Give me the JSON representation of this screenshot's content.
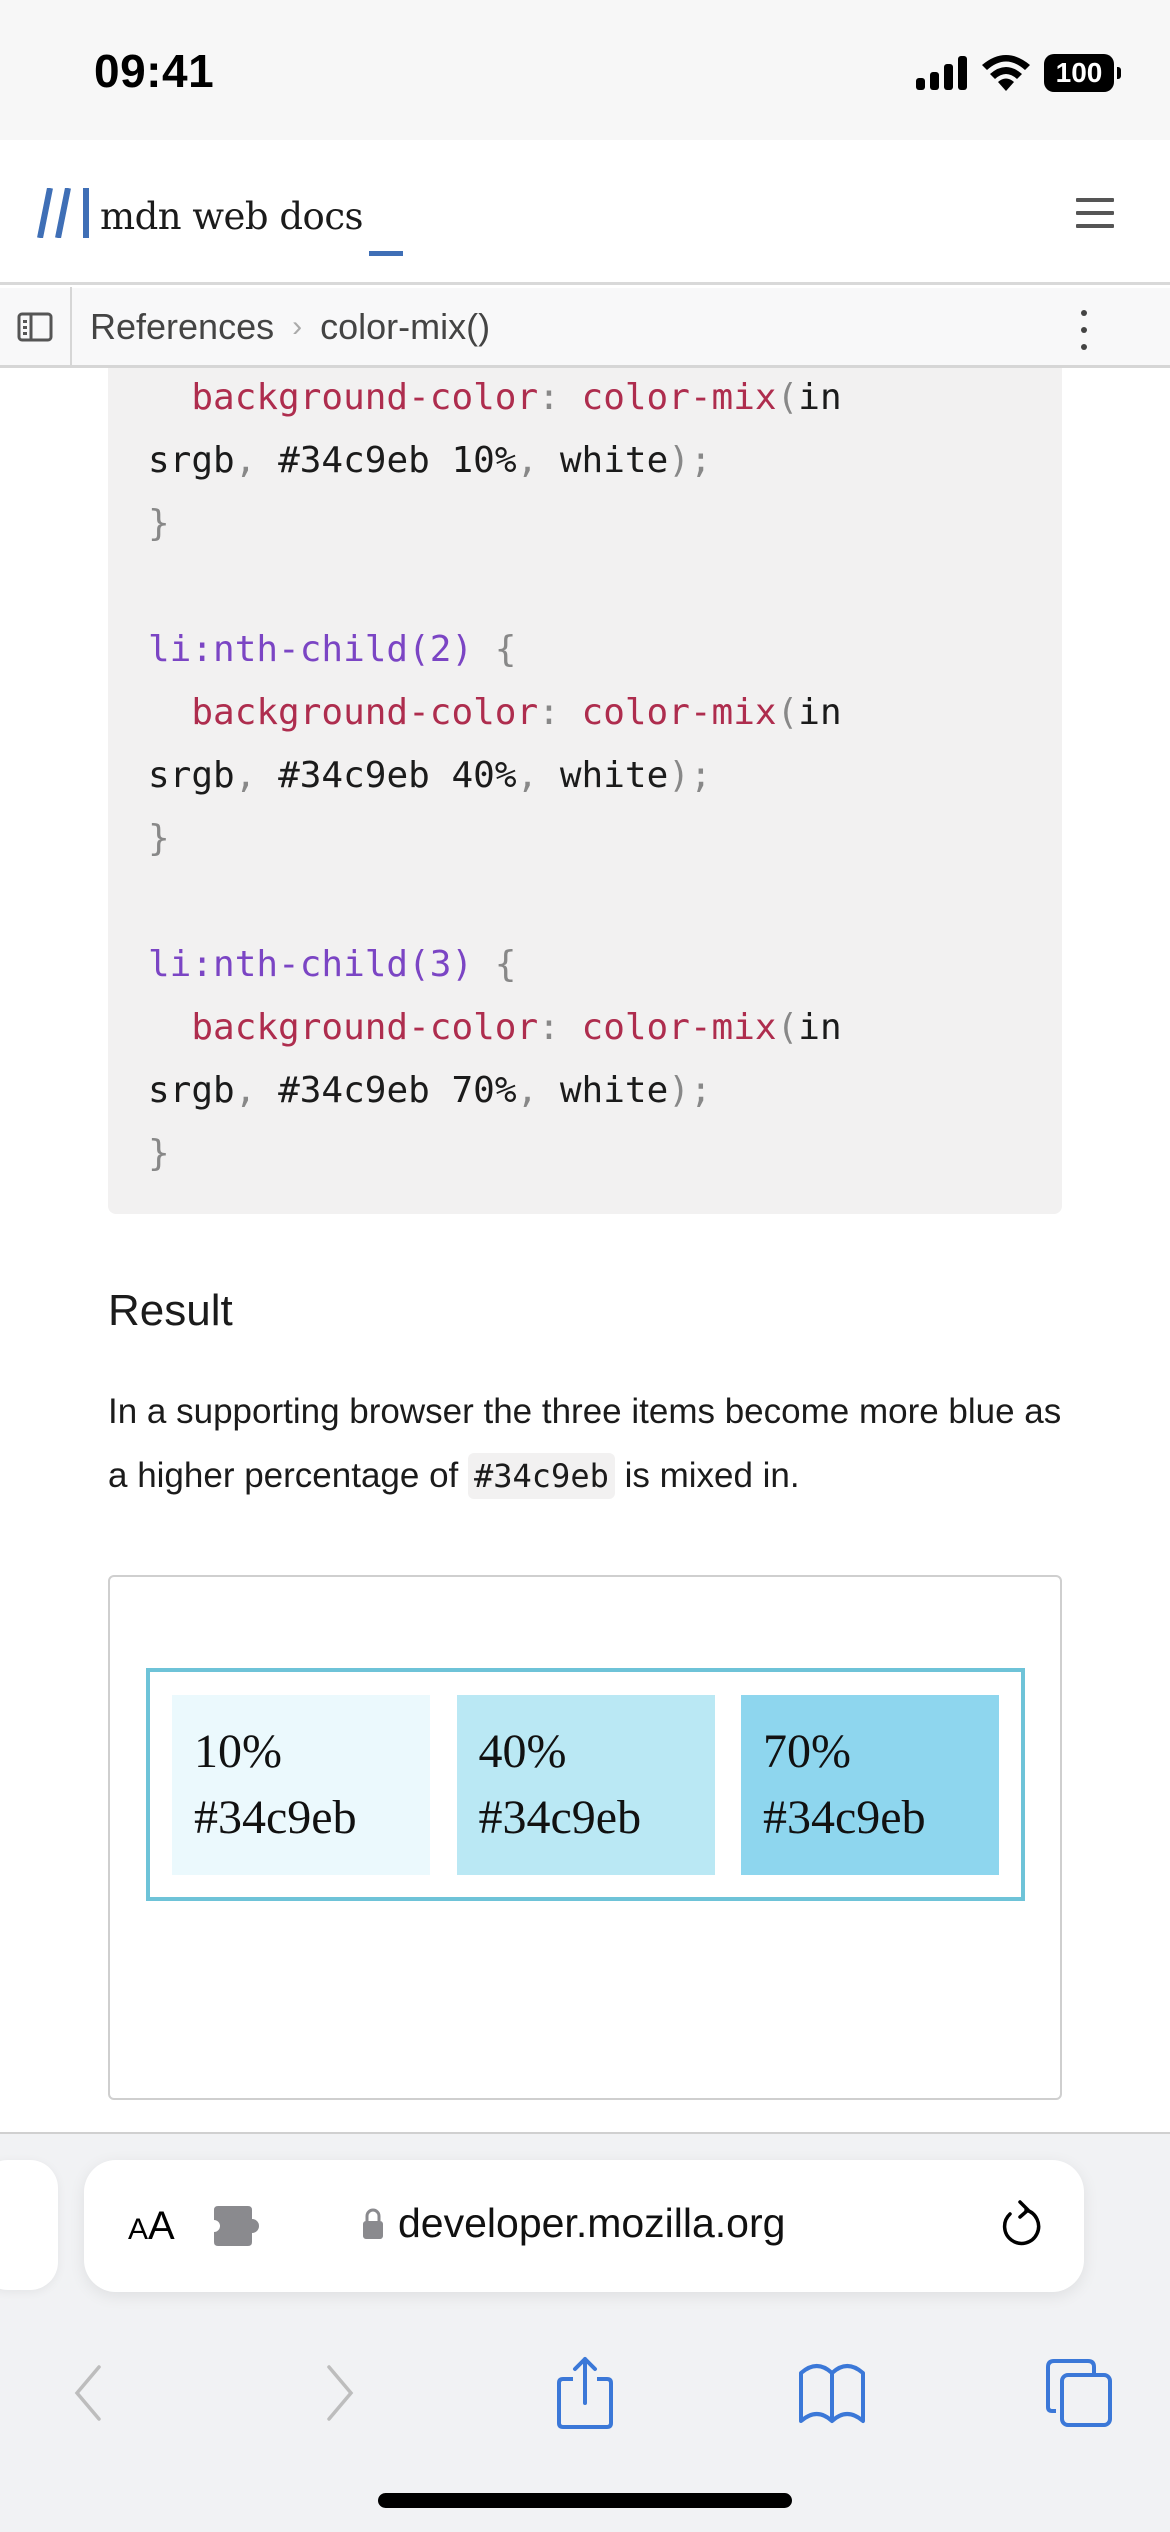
{
  "status_bar": {
    "time": "09:41",
    "battery_level": "100",
    "icons": [
      "cellular-signal-icon",
      "wifi-icon",
      "battery-icon"
    ]
  },
  "header": {
    "logo_text": "mdn web docs",
    "logo_mark": "mdn-m-logo",
    "menu_icon": "hamburger-menu-icon",
    "brand_color": "#3f6fb6"
  },
  "breadcrumb": {
    "sidebar_icon": "sidebar-toggle-icon",
    "items": [
      {
        "label": "References"
      },
      {
        "label": "color-mix()"
      }
    ],
    "separator": "›",
    "more_icon": "kebab-menu-icon"
  },
  "code": {
    "lines": [
      {
        "indent": "  ",
        "prop": "background-color",
        "colon": ":",
        "fn": "color-mix",
        "open": "(",
        "kw": "in"
      },
      {
        "value_start": "srgb",
        "comma1": ",",
        "color": "#34c9eb 10%",
        "comma2": ",",
        "white": "white",
        "close": ")",
        "semi": ";"
      },
      {
        "brace": "}"
      },
      {},
      {
        "selector": "li:nth-child(2)",
        "brace": "{"
      },
      {
        "indent": "  ",
        "prop": "background-color",
        "colon": ":",
        "fn": "color-mix",
        "open": "(",
        "kw": "in"
      },
      {
        "value_start": "srgb",
        "comma1": ",",
        "color": "#34c9eb 40%",
        "comma2": ",",
        "white": "white",
        "close": ")",
        "semi": ";"
      },
      {
        "brace": "}"
      },
      {},
      {
        "selector": "li:nth-child(3)",
        "brace": "{"
      },
      {
        "indent": "  ",
        "prop": "background-color",
        "colon": ":",
        "fn": "color-mix",
        "open": "(",
        "kw": "in"
      },
      {
        "value_start": "srgb",
        "comma1": ",",
        "color": "#34c9eb 70%",
        "comma2": ",",
        "white": "white",
        "close": ")",
        "semi": ";"
      },
      {
        "brace": "}"
      }
    ]
  },
  "result": {
    "heading": "Result",
    "desc_before": "In a supporting browser the three items become more blue as a higher percentage of ",
    "desc_code": "#34c9eb",
    "desc_after": " is mixed in.",
    "demo_border_color": "#6ec3d8",
    "items": [
      {
        "percent": "10%",
        "color_label": "#34c9eb",
        "bg": "#ebf9fd"
      },
      {
        "percent": "40%",
        "color_label": "#34c9eb",
        "bg": "#bae8f4"
      },
      {
        "percent": "70%",
        "color_label": "#34c9eb",
        "bg": "#8ed6ee"
      }
    ]
  },
  "safari": {
    "reader_label_small": "A",
    "reader_label_large": "A",
    "extension_icon": "puzzle-piece-icon",
    "lock_icon": "lock-icon",
    "url": "developer.mozilla.org",
    "reload_icon": "reload-icon",
    "toolbar": {
      "back": "back-chevron-icon",
      "forward": "forward-chevron-icon",
      "share": "share-icon",
      "bookmarks": "bookmarks-book-icon",
      "tabs": "tabs-icon"
    },
    "accent_color": "#3b78d8"
  }
}
